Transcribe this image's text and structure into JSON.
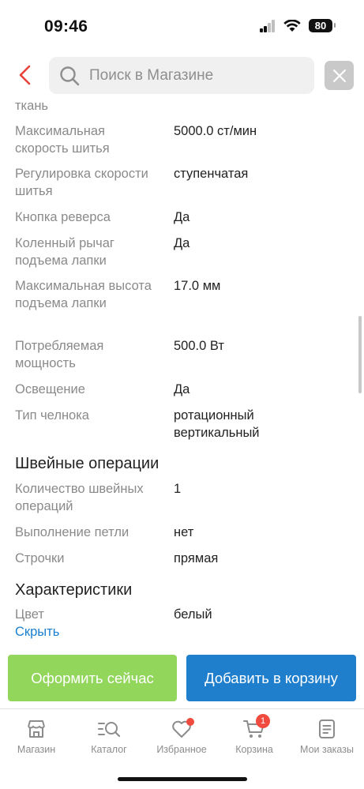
{
  "status": {
    "time": "09:46",
    "battery": "80"
  },
  "search": {
    "placeholder": "Поиск в Магазине"
  },
  "specs_top": [
    {
      "key": "ткань",
      "value": ""
    },
    {
      "key": "Максимальная скорость шитья",
      "value": "5000.0 ст/мин"
    },
    {
      "key": "Регулировка скорости шитья",
      "value": "ступенчатая"
    },
    {
      "key": "Кнопка реверса",
      "value": "Да"
    },
    {
      "key": "Коленный рычаг подъема лапки",
      "value": "Да"
    },
    {
      "key": "Максимальная высота подъема лапки",
      "value": "17.0 мм"
    },
    {
      "key": "Потребляемая мощность",
      "value": "500.0 Вт"
    },
    {
      "key": "Освещение",
      "value": "Да"
    },
    {
      "key": "Тип челнока",
      "value": "ротационный вертикальный"
    }
  ],
  "section_sewing": {
    "title": "Швейные операции",
    "rows": [
      {
        "key": "Количество швейных операций",
        "value": "1"
      },
      {
        "key": "Выполнение петли",
        "value": "нет"
      },
      {
        "key": "Строчки",
        "value": "прямая"
      }
    ]
  },
  "section_specs": {
    "title": "Характеристики",
    "rows": [
      {
        "key": "Цвет",
        "value": "белый"
      }
    ],
    "hide_link": "Скрыть"
  },
  "actions": {
    "buy_now": "Оформить сейчас",
    "add_to_cart": "Добавить в корзину"
  },
  "tabs": [
    {
      "label": "Магазин"
    },
    {
      "label": "Каталог"
    },
    {
      "label": "Избранное"
    },
    {
      "label": "Корзина",
      "badge": "1"
    },
    {
      "label": "Мои заказы"
    }
  ],
  "colors": {
    "accent_blue": "#1f7fcc",
    "accent_green": "#92d65c",
    "back_red": "#e8423a",
    "badge_red": "#f04b3e"
  }
}
